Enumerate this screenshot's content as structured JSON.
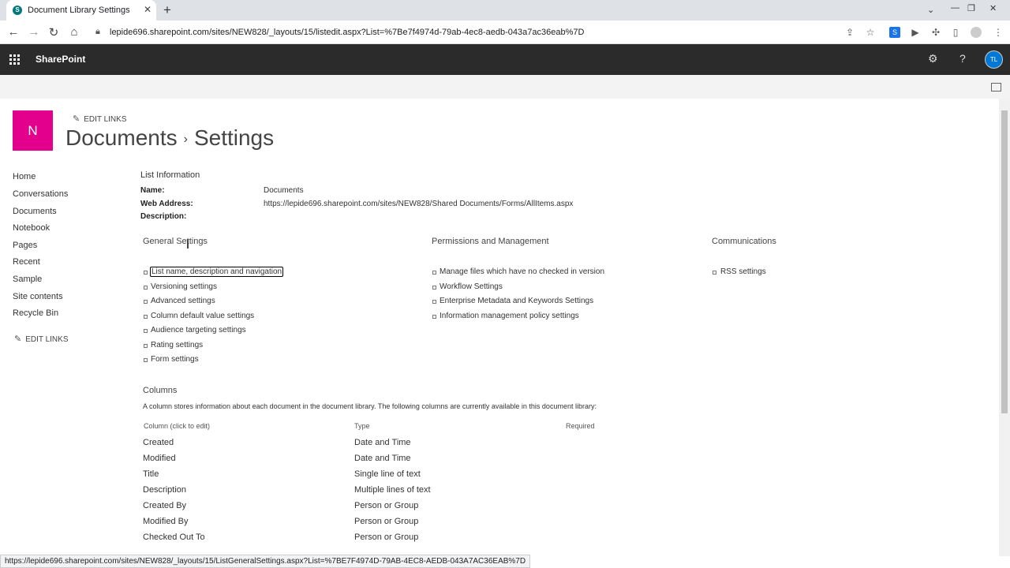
{
  "browser": {
    "tab_title": "Document Library Settings",
    "url": "lepide696.sharepoint.com/sites/NEW828/_layouts/15/listedit.aspx?List=%7Be7f4974d-79ab-4ec8-aedb-043a7ac36eab%7D",
    "status_url": "https://lepide696.sharepoint.com/sites/NEW828/_layouts/15/ListGeneralSettings.aspx?List=%7BE7F4974D-79AB-4EC8-AEDB-043A7AC36EAB%7D"
  },
  "suite": {
    "brand": "SharePoint",
    "avatar_initials": "TL",
    "avatar_color": "#0078d4"
  },
  "site": {
    "logo_letter": "N",
    "logo_color": "#e3008c",
    "edit_links": "EDIT LINKS",
    "title_part1": "Documents",
    "title_sep": "›",
    "title_part2": "Settings"
  },
  "nav": {
    "items": [
      "Home",
      "Conversations",
      "Documents",
      "Notebook",
      "Pages",
      "Recent",
      "Sample",
      "Site contents",
      "Recycle Bin"
    ],
    "edit_links": "EDIT LINKS"
  },
  "list_info": {
    "heading": "List Information",
    "name_label": "Name:",
    "name_value": "Documents",
    "web_label": "Web Address:",
    "web_value": "https://lepide696.sharepoint.com/sites/NEW828/Shared Documents/Forms/AllItems.aspx",
    "desc_label": "Description:"
  },
  "general": {
    "heading": "General Settings",
    "links": [
      "List name, description and navigation",
      "Versioning settings",
      "Advanced settings",
      "Column default value settings",
      "Audience targeting settings",
      "Rating settings",
      "Form settings"
    ]
  },
  "permissions": {
    "heading": "Permissions and Management",
    "links": [
      "Manage files which have no checked in version",
      "Workflow Settings",
      "Enterprise Metadata and Keywords Settings",
      "Information management policy settings"
    ]
  },
  "communications": {
    "heading": "Communications",
    "links": [
      "RSS settings"
    ]
  },
  "columns": {
    "heading": "Columns",
    "description": "A column stores information about each document in the document library. The following columns are currently available in this document library:",
    "headers": [
      "Column (click to edit)",
      "Type",
      "Required"
    ],
    "rows": [
      [
        "Created",
        "Date and Time"
      ],
      [
        "Modified",
        "Date and Time"
      ],
      [
        "Title",
        "Single line of text"
      ],
      [
        "Description",
        "Multiple lines of text"
      ],
      [
        "Created By",
        "Person or Group"
      ],
      [
        "Modified By",
        "Person or Group"
      ],
      [
        "Checked Out To",
        "Person or Group"
      ]
    ]
  }
}
